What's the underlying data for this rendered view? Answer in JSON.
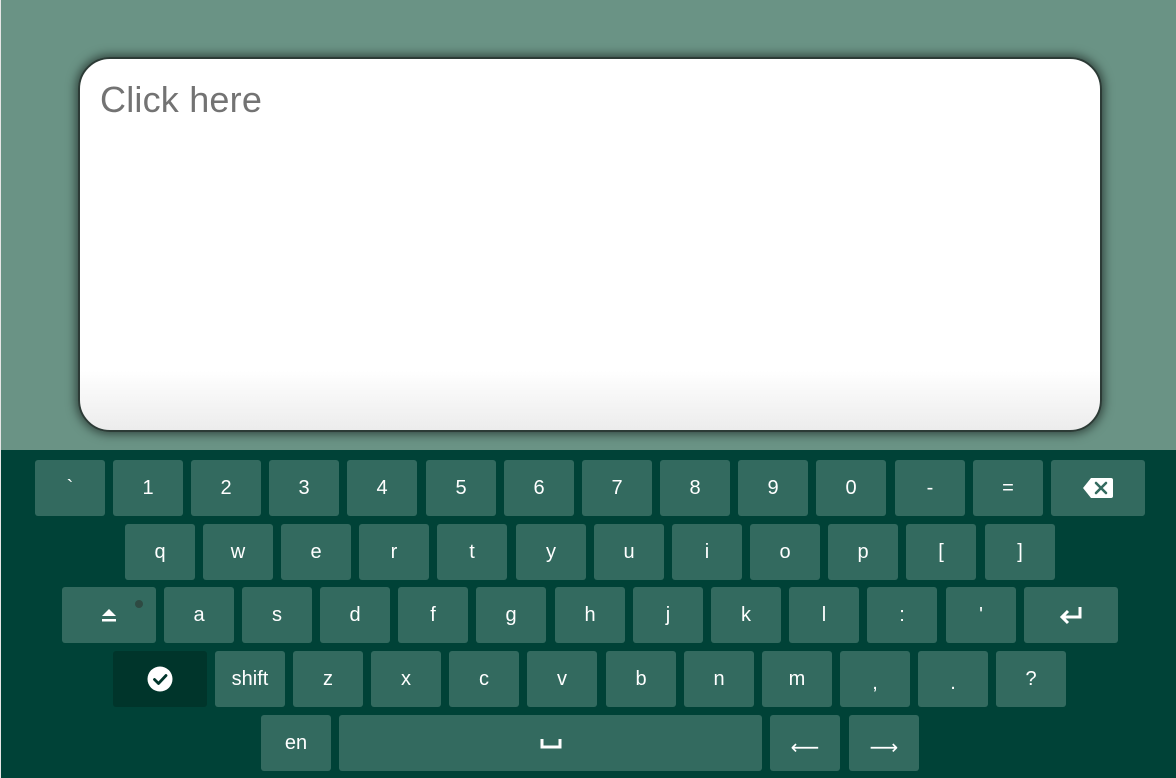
{
  "input": {
    "placeholder": "Click here"
  },
  "keyboard": {
    "row1": [
      "`",
      "1",
      "2",
      "3",
      "4",
      "5",
      "6",
      "7",
      "8",
      "9",
      "0",
      "-",
      "="
    ],
    "row2": [
      "q",
      "w",
      "e",
      "r",
      "t",
      "y",
      "u",
      "i",
      "o",
      "p",
      "[",
      "]"
    ],
    "row3": [
      "a",
      "s",
      "d",
      "f",
      "g",
      "h",
      "j",
      "k",
      "l",
      ":",
      "'"
    ],
    "row4": [
      "z",
      "x",
      "c",
      "v",
      "b",
      "n",
      "m",
      ",",
      ".",
      "?"
    ],
    "shift_label": "shift",
    "language_label": "en",
    "left_arrow_label": "⟵",
    "right_arrow_label": "⟶",
    "icons": {
      "backspace": "backspace-icon",
      "caps_lock": "caps-lock-icon",
      "enter": "enter-icon",
      "done": "checkmark-icon",
      "space": "space-bar-icon"
    },
    "colors": {
      "background": "#004237",
      "key": "#336a5f",
      "active_key": "#00352b",
      "page_background": "#6a9385"
    }
  }
}
